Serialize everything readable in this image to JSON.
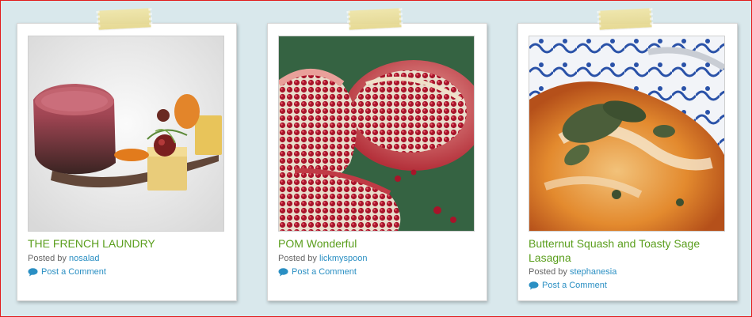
{
  "colors": {
    "page_background": "#d9e8ec",
    "border_accent": "#e21b1b",
    "title_green": "#5a9e1c",
    "link_blue": "#2a8fc3",
    "tape_yellow": "#e9dc95"
  },
  "posts": [
    {
      "title": "THE FRENCH LAUNDRY",
      "posted_by_label": "Posted by",
      "author": "nosalad",
      "comment_label": "Post a Comment",
      "photo_icon": "plated-beef-dish-photo"
    },
    {
      "title": "POM Wonderful",
      "posted_by_label": "Posted by",
      "author": "lickmyspoon",
      "comment_label": "Post a Comment",
      "photo_icon": "pomegranate-photo"
    },
    {
      "title": "Butternut Squash and Toasty Sage Lasagna",
      "posted_by_label": "Posted by",
      "author": "stephanesia",
      "comment_label": "Post a Comment",
      "photo_icon": "lasagna-photo"
    }
  ]
}
